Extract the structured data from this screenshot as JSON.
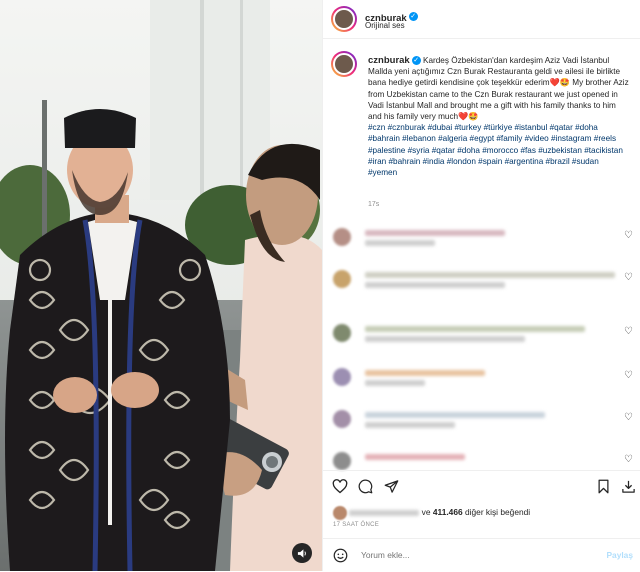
{
  "header": {
    "username": "cznburak",
    "subtitle": "Orijinal ses"
  },
  "caption": {
    "username": "cznburak",
    "text_tr": "Kardeş Özbekistan'dan kardeşim Aziz Vadi İstanbul Mallda yeni açtığımız Czn Burak Restauranta geldi ve ailesi ile birlikte bana hediye getirdi kendisine çok teşekkür ederim",
    "emoji_tr": "❤️🤩",
    "text_en": "My brother Aziz from Uzbekistan came to the Czn Burak restaurant we just opened in Vadi İstanbul Mall and brought me a gift with his family thanks to him and his family very much",
    "emoji_en": "❤️🤩",
    "hashtags": "#czn #cznburak #dubai #turkey #türkiye #istanbul #qatar #doha #bahrain #lebanon #algeria #egypt #family #video #instagram #reels #palestine #syria #qatar #doha #morocco #fas #uzbekistan #tacikistan #iran #bahrain #india #london #spain #argentina #brazil #sudan #yemen",
    "time": "17s"
  },
  "likes": {
    "prefix": "ve",
    "count": "411.466",
    "suffix": "diğer kişi beğendi"
  },
  "posted_ago": "17 SAAT ÖNCE",
  "comment_box": {
    "placeholder": "Yorum ekle...",
    "post_label": "Paylaş"
  }
}
